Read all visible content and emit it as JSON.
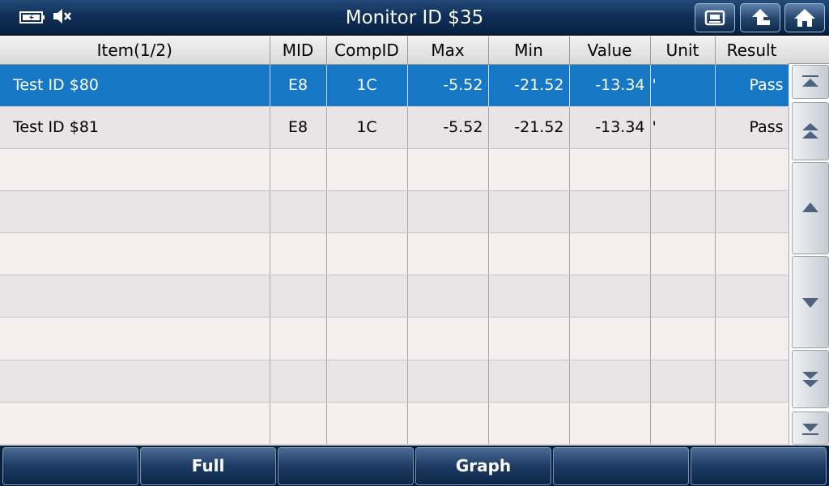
{
  "title": "Monitor ID $35",
  "status_icons": [
    "battery-charging-icon",
    "speaker-muted-icon"
  ],
  "toolbar_top": [
    "print-icon",
    "back-arrow-icon",
    "home-icon"
  ],
  "table": {
    "headers": [
      "Item(1/2)",
      "MID",
      "CompID",
      "Max",
      "Min",
      "Value",
      "Unit",
      "Result"
    ],
    "rows": [
      {
        "item": "Test ID $80",
        "mid": "E8",
        "compid": "1C",
        "max": "-5.52",
        "min": "-21.52",
        "value": "-13.34",
        "unit": "'",
        "result": "Pass"
      },
      {
        "item": "Test ID $81",
        "mid": "E8",
        "compid": "1C",
        "max": "-5.52",
        "min": "-21.52",
        "value": "-13.34",
        "unit": "'",
        "result": "Pass"
      }
    ],
    "selected_row": 0
  },
  "scroll_buttons": [
    "scroll-top-icon",
    "page-up-icon",
    "line-up-icon",
    "line-down-icon",
    "page-down-icon",
    "scroll-bottom-icon"
  ],
  "bottom_buttons": [
    "",
    "Full",
    "",
    "Graph",
    "",
    ""
  ],
  "colors": {
    "title_bar": "#10305a",
    "selected_row": "#1677c6",
    "row_odd": "#e9e4e5",
    "row_even": "#f6efef"
  }
}
